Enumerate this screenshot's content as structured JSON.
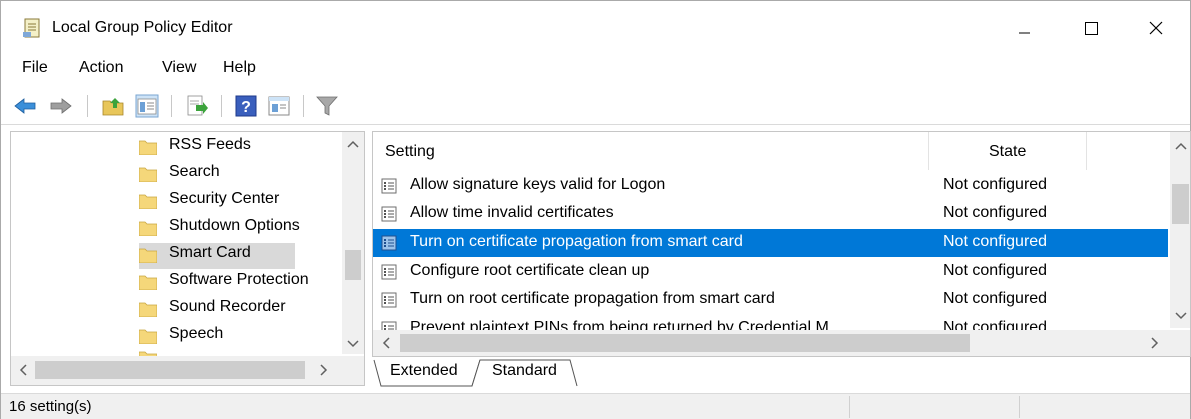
{
  "window": {
    "title": "Local Group Policy Editor",
    "icon": "policy-editor-icon",
    "controls": [
      "minimize",
      "maximize",
      "close"
    ]
  },
  "menu": {
    "items": [
      {
        "label": "File"
      },
      {
        "label": "Action"
      },
      {
        "label": "View"
      },
      {
        "label": "Help"
      }
    ]
  },
  "toolbar": {
    "buttons": [
      "back-icon",
      "forward-icon",
      "up-folder-icon",
      "show-hide-tree-icon",
      "export-list-icon",
      "help-icon",
      "properties-icon",
      "filter-icon"
    ]
  },
  "tree": {
    "items": [
      {
        "label": "RSS Feeds"
      },
      {
        "label": "Search"
      },
      {
        "label": "Security Center"
      },
      {
        "label": "Shutdown Options"
      },
      {
        "label": "Smart Card",
        "selected": true
      },
      {
        "label": "Software Protection"
      },
      {
        "label": "Sound Recorder"
      },
      {
        "label": "Speech"
      }
    ]
  },
  "list": {
    "columns": {
      "setting": "Setting",
      "state": "State"
    },
    "rows": [
      {
        "name": "Allow signature keys valid for Logon",
        "state": "Not configured"
      },
      {
        "name": "Allow time invalid certificates",
        "state": "Not configured"
      },
      {
        "name": "Turn on certificate propagation from smart card",
        "state": "Not configured",
        "selected": true
      },
      {
        "name": "Configure root certificate clean up",
        "state": "Not configured"
      },
      {
        "name": "Turn on root certificate propagation from smart card",
        "state": "Not configured"
      },
      {
        "name": "Prevent plaintext PINs from being returned by Credential M",
        "state": "Not configured"
      }
    ]
  },
  "tabs": [
    {
      "label": "Extended"
    },
    {
      "label": "Standard",
      "active": true
    }
  ],
  "status": {
    "text": "16 setting(s)"
  },
  "colors": {
    "selection": "#0078d7",
    "tree_selection": "#d9d9d9"
  }
}
